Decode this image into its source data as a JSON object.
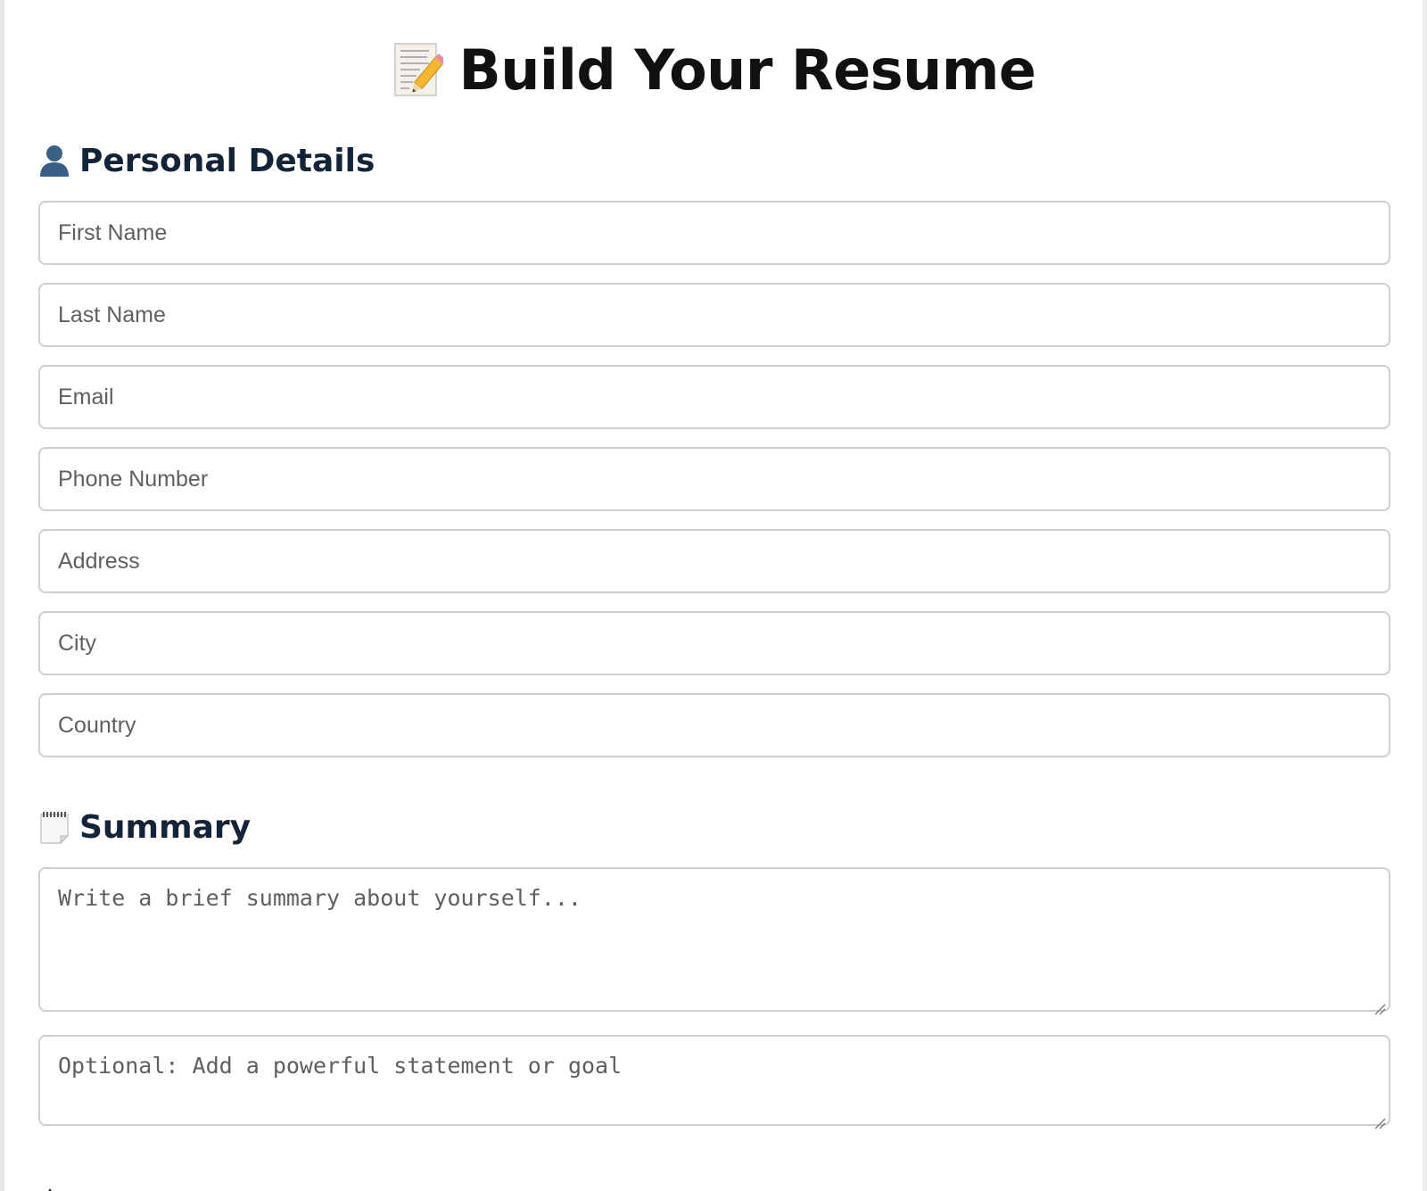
{
  "page": {
    "title": "Build Your Resume",
    "title_icon": "memo-icon"
  },
  "personal": {
    "heading": "Personal Details",
    "icon": "person-silhouette-icon",
    "fields": [
      {
        "placeholder": "First Name"
      },
      {
        "placeholder": "Last Name"
      },
      {
        "placeholder": "Email"
      },
      {
        "placeholder": "Phone Number"
      },
      {
        "placeholder": "Address"
      },
      {
        "placeholder": "City"
      },
      {
        "placeholder": "Country"
      }
    ]
  },
  "summary": {
    "heading": "Summary",
    "icon": "notepad-icon",
    "summary_placeholder": "Write a brief summary about yourself...",
    "statement_placeholder": "Optional: Add a powerful statement or goal"
  },
  "colors": {
    "heading": "#13233a",
    "title": "#111111",
    "border": "#cfcfcf",
    "placeholder": "#5f5f5f"
  }
}
